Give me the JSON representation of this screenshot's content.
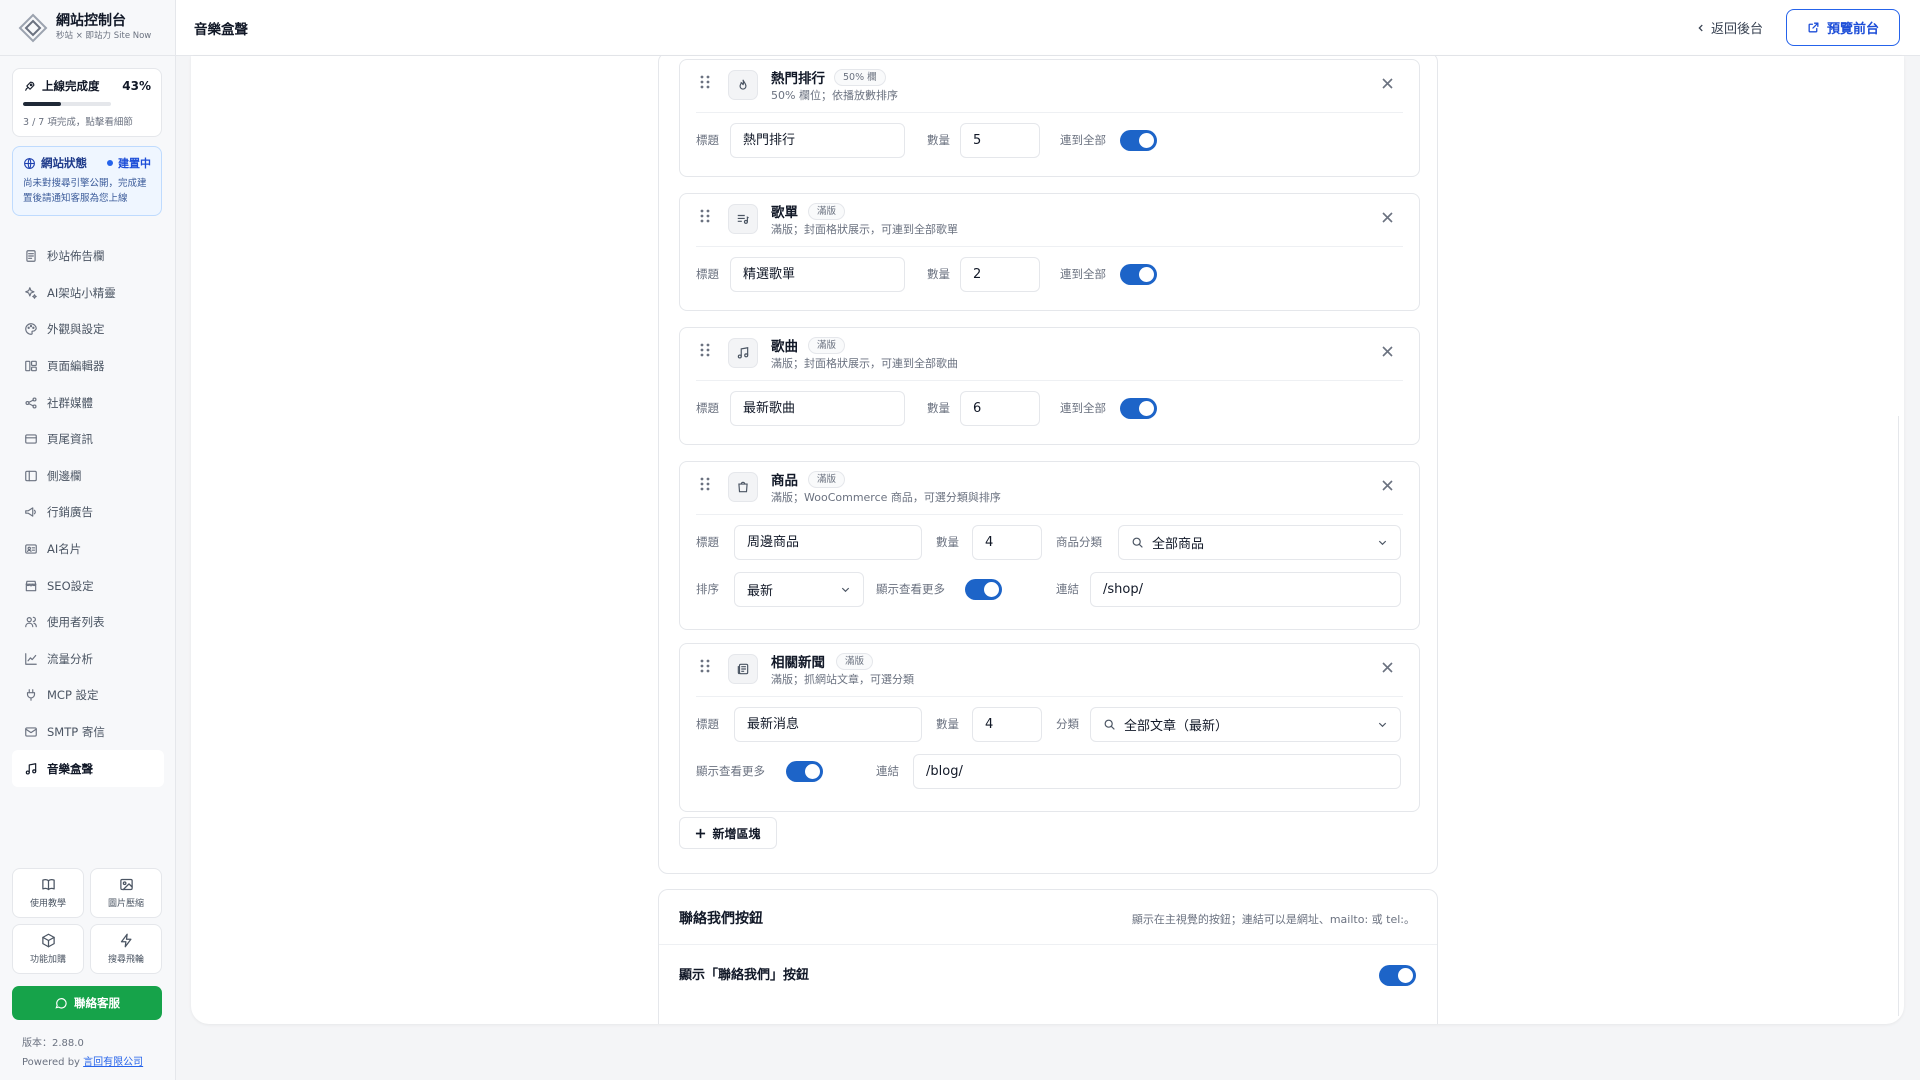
{
  "brand": {
    "title": "網站控制台",
    "subtitle": "秒站 × 即站力 Site Now"
  },
  "progress": {
    "title": "上線完成度",
    "percent_label": "43%",
    "percent": 43,
    "note": "3 / 7 項完成，點擊看細節"
  },
  "site_status": {
    "title": "網站狀態",
    "badge": "建置中",
    "description": "尚未對搜尋引擎公開，完成建置後請通知客服為您上線"
  },
  "nav": {
    "items": [
      {
        "label": "秒站佈告欄",
        "icon": "bulletin-icon"
      },
      {
        "label": "AI架站小精靈",
        "icon": "sparkles-icon"
      },
      {
        "label": "外觀與設定",
        "icon": "palette-icon"
      },
      {
        "label": "頁面編輯器",
        "icon": "layout-icon"
      },
      {
        "label": "社群媒體",
        "icon": "share-icon"
      },
      {
        "label": "頁尾資訊",
        "icon": "card-icon"
      },
      {
        "label": "側邊欄",
        "icon": "sidebar-icon"
      },
      {
        "label": "行銷廣告",
        "icon": "megaphone-icon"
      },
      {
        "label": "AI名片",
        "icon": "id-card-icon"
      },
      {
        "label": "SEO設定",
        "icon": "store-icon"
      },
      {
        "label": "使用者列表",
        "icon": "users-icon"
      },
      {
        "label": "流量分析",
        "icon": "chart-icon"
      },
      {
        "label": "MCP 設定",
        "icon": "plug-icon"
      },
      {
        "label": "SMTP 寄信",
        "icon": "mail-icon"
      },
      {
        "label": "音樂盒聲",
        "icon": "music-icon",
        "active": true
      }
    ]
  },
  "tools": [
    {
      "label": "使用教學",
      "icon": "book-icon"
    },
    {
      "label": "圖片壓縮",
      "icon": "image-icon"
    },
    {
      "label": "功能加購",
      "icon": "package-icon"
    },
    {
      "label": "搜尋飛輪",
      "icon": "zap-icon"
    }
  ],
  "contact_button": "聯絡客服",
  "version": "版本：2.88.0",
  "powered_prefix": "Powered by ",
  "powered_company": "言回有限公司",
  "header": {
    "title": "音樂盒聲",
    "back": "返回後台",
    "preview": "預覽前台"
  },
  "blocks": {
    "hot": {
      "title": "熱門排行",
      "badge": "50% 欄",
      "desc": "50% 欄位；依播放數排序",
      "title_label": "標題",
      "title_value": "熱門排行",
      "count_label": "數量",
      "count_value": "5",
      "link_all_label": "連到全部",
      "link_all_on": true
    },
    "playlist": {
      "title": "歌單",
      "badge": "滿版",
      "desc": "滿版；封面格狀展示，可連到全部歌單",
      "title_label": "標題",
      "title_value": "精選歌單",
      "count_label": "數量",
      "count_value": "2",
      "link_all_label": "連到全部",
      "link_all_on": true
    },
    "songs": {
      "title": "歌曲",
      "badge": "滿版",
      "desc": "滿版；封面格狀展示，可連到全部歌曲",
      "title_label": "標題",
      "title_value": "最新歌曲",
      "count_label": "數量",
      "count_value": "6",
      "link_all_label": "連到全部",
      "link_all_on": true
    },
    "products": {
      "title": "商品",
      "badge": "滿版",
      "desc": "滿版；WooCommerce 商品，可選分類與排序",
      "title_label": "標題",
      "title_value": "周邊商品",
      "count_label": "數量",
      "count_value": "4",
      "category_label": "商品分類",
      "category_value": "全部商品",
      "sort_label": "排序",
      "sort_value": "最新",
      "more_label": "顯示查看更多",
      "more_on": true,
      "link_label": "連結",
      "link_value": "/shop/"
    },
    "news": {
      "title": "相關新聞",
      "badge": "滿版",
      "desc": "滿版；抓網站文章，可選分類",
      "title_label": "標題",
      "title_value": "最新消息",
      "count_label": "數量",
      "count_value": "4",
      "category_label": "分類",
      "category_value": "全部文章（最新）",
      "more_label": "顯示查看更多",
      "more_on": true,
      "link_label": "連結",
      "link_value": "/blog/"
    }
  },
  "add_block": "新增區塊",
  "contact_section": {
    "title": "聯絡我們按鈕",
    "desc": "顯示在主視覺的按鈕；連結可以是網址、mailto: 或 tel:。",
    "show_label": "顯示「聯絡我們」按鈕",
    "show_on": true
  },
  "colors": {
    "accent": "#1d64c8",
    "green": "#16a34a",
    "border": "#e5e7eb"
  }
}
